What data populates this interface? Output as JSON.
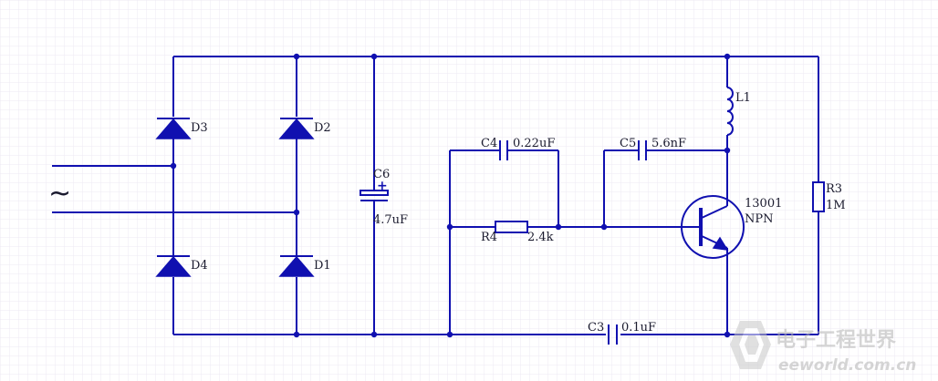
{
  "diagram": {
    "background_color": "#ffffff",
    "grid_color": "#eaeaf2",
    "wire_color": "#1010b0",
    "label_color": "#1a1a2e",
    "ac_symbol": "~",
    "components": {
      "d1": {
        "name": "D1"
      },
      "d2": {
        "name": "D2"
      },
      "d3": {
        "name": "D3"
      },
      "d4": {
        "name": "D4"
      },
      "c3": {
        "name": "C3",
        "value": "0.1uF"
      },
      "c4": {
        "name": "C4",
        "value": "0.22uF"
      },
      "c5": {
        "name": "C5",
        "value": "5.6nF"
      },
      "c6": {
        "name": "C6",
        "value": "4.7uF",
        "polarity": "+"
      },
      "r3": {
        "name": "R3",
        "value": "1M"
      },
      "r4": {
        "name": "R4",
        "value": "2.4k"
      },
      "l1": {
        "name": "L1"
      },
      "q1": {
        "part": "13001",
        "type": "NPN"
      }
    }
  },
  "watermark": {
    "title": "电子工程世界",
    "url": "eeworld.com.cn"
  }
}
